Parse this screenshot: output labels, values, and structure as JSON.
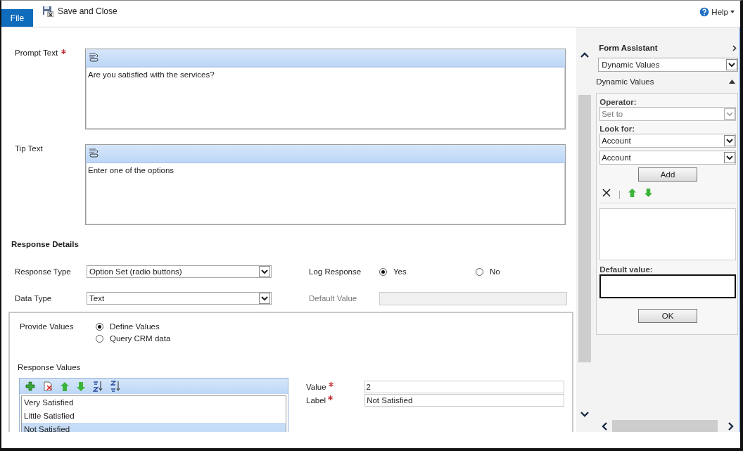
{
  "toolbar": {
    "file_tab": "File",
    "save_and_close": "Save and Close",
    "help": "Help"
  },
  "prompt_text": {
    "label": "Prompt Text",
    "required": true,
    "value": "Are you satisfied with the services?"
  },
  "tip_text": {
    "label": "Tip Text",
    "required": false,
    "value": "Enter one of the options"
  },
  "response_details": {
    "heading": "Response Details",
    "response_type": {
      "label": "Response Type",
      "value": "Option Set (radio buttons)"
    },
    "log_response": {
      "label": "Log Response",
      "options": [
        {
          "label": "Yes",
          "selected": true
        },
        {
          "label": "No",
          "selected": false
        }
      ]
    },
    "data_type": {
      "label": "Data Type",
      "value": "Text"
    },
    "default_value": {
      "label": "Default Value",
      "disabled": true
    }
  },
  "provide_values": {
    "label": "Provide Values",
    "options": [
      {
        "label": "Define Values",
        "selected": true
      },
      {
        "label": "Query CRM data",
        "selected": false
      }
    ]
  },
  "response_values": {
    "label": "Response Values",
    "items": [
      {
        "label": "Very Satisfied",
        "selected": false
      },
      {
        "label": "Little Satisfied",
        "selected": false
      },
      {
        "label": "Not Satisfied",
        "selected": true
      }
    ]
  },
  "value_field": {
    "label": "Value",
    "required": true,
    "value": "2"
  },
  "label_field": {
    "label": "Label",
    "required": true,
    "value": "Not Satisfied"
  },
  "form_assistant": {
    "title": "Form Assistant",
    "selector": "Dynamic Values",
    "section": "Dynamic Values",
    "operator": {
      "label": "Operator:",
      "value": "Set to",
      "disabled": true
    },
    "look_for": {
      "label": "Look for:",
      "values": [
        "Account",
        "Account"
      ]
    },
    "add_button": "Add",
    "default_value_label": "Default value:",
    "ok_button": "OK"
  }
}
